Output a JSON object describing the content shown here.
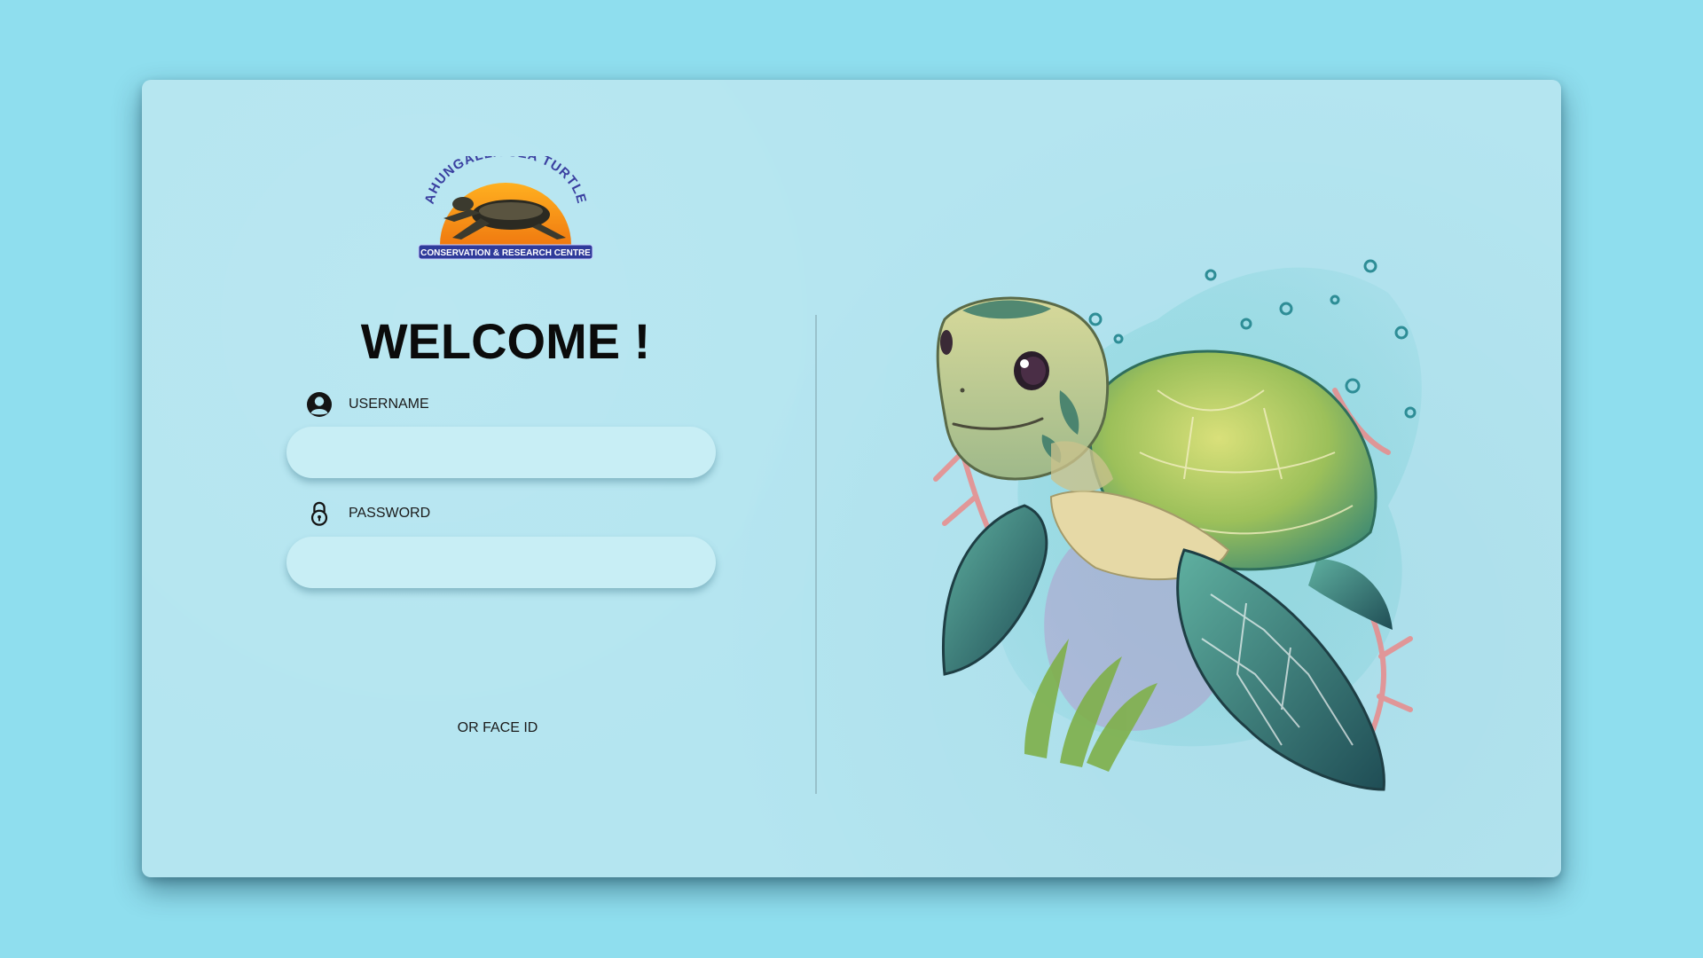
{
  "logo": {
    "arc_text": "AHUNGALLA SEA TURTLE",
    "banner_text": "CONSERVATION & RESEARCH CENTRE"
  },
  "welcome": "WELCOME !",
  "username": {
    "label": "USERNAME",
    "value": "",
    "icon": "user-circle-icon"
  },
  "password": {
    "label": "PASSWORD",
    "value": "",
    "icon": "padlock-icon"
  },
  "face_id": "OR FACE ID",
  "colors": {
    "page_background": "#8fdeee",
    "card_background": "#b4e5f0",
    "input_background": "#c8eef5",
    "text": "#0b0b0b"
  }
}
